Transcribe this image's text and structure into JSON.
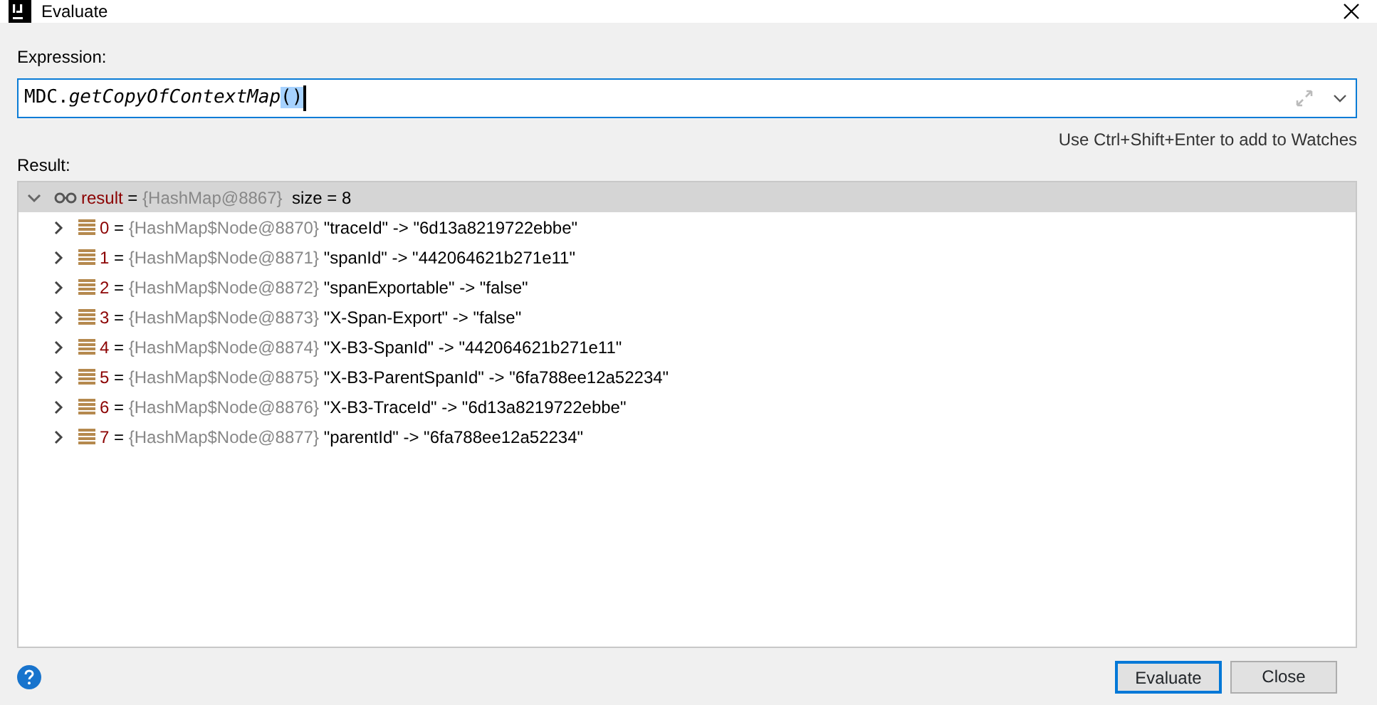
{
  "window": {
    "title": "Evaluate"
  },
  "expression": {
    "label": "Expression:",
    "segments": [
      {
        "text": "MDC.",
        "kind": "plain"
      },
      {
        "text": "getCopyOfContextMap",
        "kind": "italic"
      },
      {
        "text": "()",
        "kind": "selected"
      }
    ],
    "hint": "Use Ctrl+Shift+Enter to add to Watches"
  },
  "result": {
    "label": "Result:",
    "tree": [
      {
        "name": "result",
        "separator": "=",
        "type": "{HashMap@8867}",
        "value": "size = 8",
        "expanded": true,
        "selected": true,
        "kind": "watch",
        "children": [
          {
            "name": "0",
            "separator": "=",
            "type": "{HashMap$Node@8870}",
            "value": "\"traceId\" -> \"6d13a8219722ebbe\"",
            "expanded": false,
            "selected": false,
            "kind": "entry"
          },
          {
            "name": "1",
            "separator": "=",
            "type": "{HashMap$Node@8871}",
            "value": "\"spanId\" -> \"442064621b271e11\"",
            "expanded": false,
            "selected": false,
            "kind": "entry"
          },
          {
            "name": "2",
            "separator": "=",
            "type": "{HashMap$Node@8872}",
            "value": "\"spanExportable\" -> \"false\"",
            "expanded": false,
            "selected": false,
            "kind": "entry"
          },
          {
            "name": "3",
            "separator": "=",
            "type": "{HashMap$Node@8873}",
            "value": "\"X-Span-Export\" -> \"false\"",
            "expanded": false,
            "selected": false,
            "kind": "entry"
          },
          {
            "name": "4",
            "separator": "=",
            "type": "{HashMap$Node@8874}",
            "value": "\"X-B3-SpanId\" -> \"442064621b271e11\"",
            "expanded": false,
            "selected": false,
            "kind": "entry"
          },
          {
            "name": "5",
            "separator": "=",
            "type": "{HashMap$Node@8875}",
            "value": "\"X-B3-ParentSpanId\" -> \"6fa788ee12a52234\"",
            "expanded": false,
            "selected": false,
            "kind": "entry"
          },
          {
            "name": "6",
            "separator": "=",
            "type": "{HashMap$Node@8876}",
            "value": "\"X-B3-TraceId\" -> \"6d13a8219722ebbe\"",
            "expanded": false,
            "selected": false,
            "kind": "entry"
          },
          {
            "name": "7",
            "separator": "=",
            "type": "{HashMap$Node@8877}",
            "value": "\"parentId\" -> \"6fa788ee12a52234\"",
            "expanded": false,
            "selected": false,
            "kind": "entry"
          }
        ]
      }
    ]
  },
  "buttons": [
    {
      "label": "Evaluate",
      "default": true
    },
    {
      "label": "Close",
      "default": false
    }
  ]
}
